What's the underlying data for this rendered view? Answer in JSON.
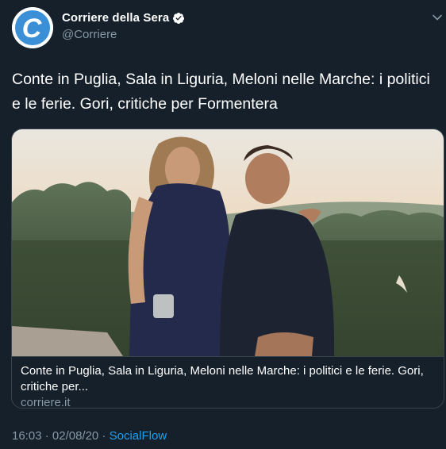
{
  "account": {
    "display_name": "Corriere della Sera",
    "handle": "@Corriere",
    "avatar_icon": "corriere-logo-icon",
    "verified_icon": "verified-badge-icon"
  },
  "tweet": {
    "text": "Conte in Puglia, Sala in Liguria, Meloni nelle Marche: i politici e le ferie. Gori, critiche per Formentera"
  },
  "card": {
    "image": "photo-couple-at-sunset",
    "title": "Conte in Puglia, Sala in Liguria, Meloni nelle Marche: i politici e le ferie. Gori, critiche per...",
    "domain": "corriere.it"
  },
  "meta": {
    "time": "16:03",
    "separator1": " · ",
    "date": "02/08/20",
    "separator2": " · ",
    "source": "SocialFlow"
  },
  "colors": {
    "background": "#15202b",
    "secondary_text": "#8899a6",
    "link": "#1da1f2",
    "border": "#38444d",
    "avatar_logo": "#3b8fd6"
  }
}
